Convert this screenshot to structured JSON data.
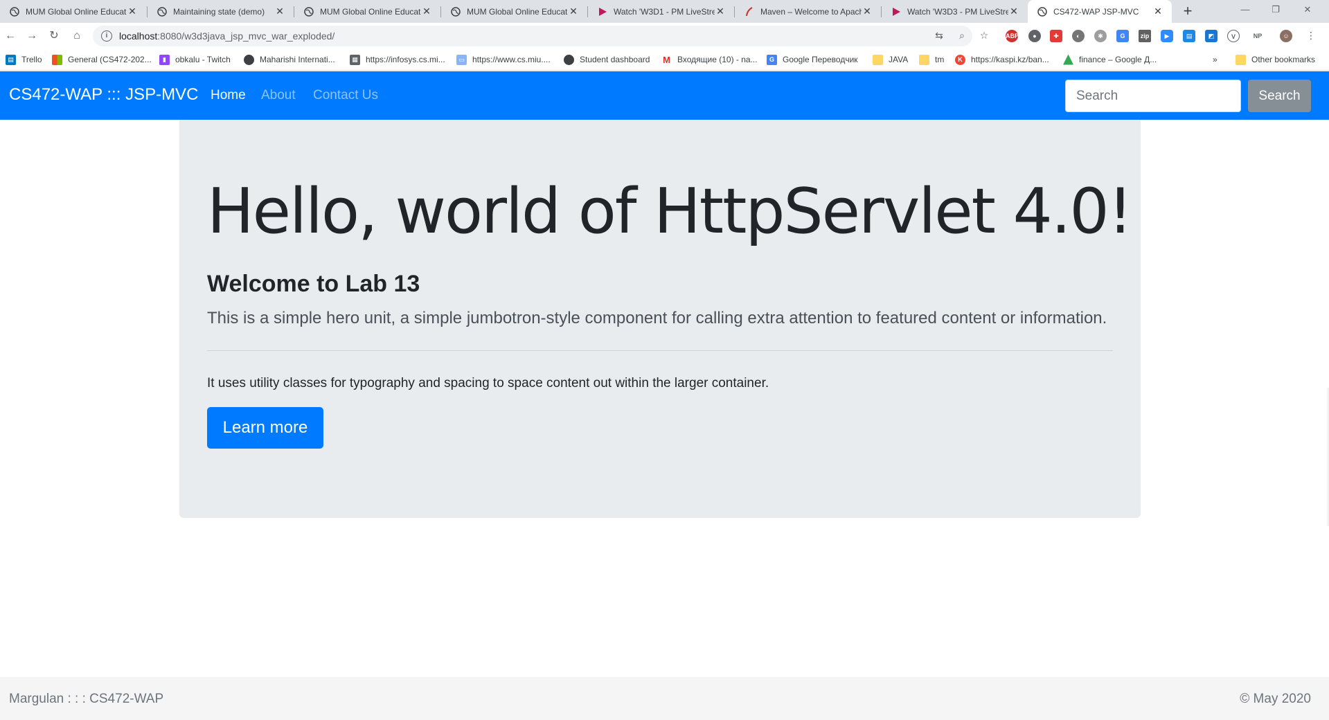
{
  "browser": {
    "tabs": [
      {
        "title": "MUM Global Online Educati",
        "icon": "globe-icon"
      },
      {
        "title": "Maintaining state (demo)",
        "icon": "globe-icon"
      },
      {
        "title": "MUM Global Online Educati",
        "icon": "globe-icon"
      },
      {
        "title": "MUM Global Online Educati",
        "icon": "globe-icon"
      },
      {
        "title": "Watch 'W3D1 - PM LiveStre",
        "icon": "play-icon"
      },
      {
        "title": "Maven – Welcome to Apach",
        "icon": "feather-icon"
      },
      {
        "title": "Watch 'W3D3 - PM LiveStre",
        "icon": "play-icon"
      },
      {
        "title": "CS472-WAP JSP-MVC",
        "icon": "globe-icon",
        "active": true
      }
    ],
    "url_host": "localhost",
    "url_path": ":8080/w3d3java_jsp_mvc_war_exploded/",
    "extension_np": "NP",
    "bookmarks": [
      {
        "label": "Trello",
        "color": "#0079bf"
      },
      {
        "label": "General (CS472-202...",
        "color": "#f25022"
      },
      {
        "label": "obkalu - Twitch",
        "color": "#9146ff"
      },
      {
        "label": "Maharishi Internati...",
        "color": "#3c4043"
      },
      {
        "label": "https://infosys.cs.mi...",
        "color": "#5f6368"
      },
      {
        "label": "https://www.cs.miu....",
        "color": "#8ab4f8"
      },
      {
        "label": "Student dashboard",
        "color": "#3c4043"
      },
      {
        "label": "Входящие (10) - na...",
        "color": "#d93025"
      },
      {
        "label": "Google Переводчик",
        "color": "#4285f4"
      },
      {
        "label": "JAVA",
        "color": "#fdd663"
      },
      {
        "label": "tm",
        "color": "#fdd663"
      },
      {
        "label": "https://kaspi.kz/ban...",
        "color": "#f14635"
      },
      {
        "label": "finance – Google Д...",
        "color": "#34a853"
      }
    ],
    "bookmarks_overflow": "»",
    "other_bookmarks": "Other bookmarks"
  },
  "site": {
    "brand": "CS472-WAP ::: JSP-MVC",
    "nav": [
      "Home",
      "About",
      "Contact Us"
    ],
    "search_placeholder": "Search",
    "search_button": "Search"
  },
  "jumbotron": {
    "display": "Hello, world of HttpServlet 4.0!",
    "title": "Welcome to Lab 13",
    "lead": "This is a simple hero unit, a simple jumbotron-style component for calling extra attention to featured content or information.",
    "body": "It uses utility classes for typography and spacing to space content out within the larger container.",
    "button": "Learn more"
  },
  "footer": {
    "left": "Margulan : : : CS472-WAP",
    "right": "© May 2020"
  },
  "colors": {
    "primary": "#007bff",
    "secondary": "#868e96",
    "jumbotron_bg": "#e9ecef",
    "footer_bg": "#f5f5f5"
  }
}
